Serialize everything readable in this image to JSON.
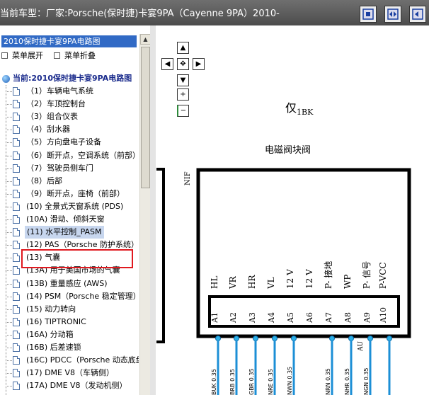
{
  "window": {
    "title": "当前车型：厂家:Porsche(保时捷)卡宴9PA（Cayenne 9PA）2010-"
  },
  "toolbar": {
    "buttons": [
      "layout-single-icon",
      "layout-split-icon",
      "layout-triple-icon"
    ]
  },
  "sidebar": {
    "header": "2010保时捷卡宴9PA电路图",
    "expand_label": "菜单展开",
    "collapse_label": "菜单折叠",
    "root_label": "当前:2010保时捷卡宴9PA电路图",
    "items": [
      "（1）车辆电气系统",
      "（2）车顶控制台",
      "（3）组合仪表",
      "（4）刮水器",
      "（5）方向盘电子设备",
      "（6）断开点，空调系统（前部）",
      "（7）驾驶员侧车门",
      "（8）后部",
      "（9）断开点，座椅（前部）",
      "(10) 全景式天窗系统 (PDS)",
      "(10A) 滑动、倾斜天窗",
      "(11) 水平控制_PASM",
      "(12) PAS（Porsche 防护系统）",
      "(13) 气囊",
      "(13A) 用于美国市场的气囊",
      "(13B) 重量感应 (AWS)",
      "(14) PSM（Porsche 稳定管理）",
      "(15) 动力转向",
      "(16) TIPTRONIC",
      "(16A) 分动箱",
      "(16B) 后差速锁",
      "(16C) PDCC（Porsche 动态底盘）",
      "(17) DME V8（车辆侧）",
      "(17A) DME V8（发动机侧）"
    ],
    "selected_index": 11
  },
  "diagram": {
    "zoom_in": "+",
    "zoom_out": "−",
    "heading_main": "仅",
    "heading_sub": "1BK",
    "module_title": "电磁阀块阀",
    "side_label": "NIF",
    "signals": [
      "HL",
      "VR",
      "HR",
      "VL",
      "12 V",
      "12 V",
      "P- 接地",
      "WP",
      "P- 信号",
      "P-VCC"
    ],
    "pins": [
      "A1",
      "A2",
      "A3",
      "A4",
      "A5",
      "A6",
      "A7",
      "A8",
      "A9",
      "A10"
    ],
    "wire_labels": [
      "BUK 0.35",
      "BRB 0.35",
      "GBR 0.35",
      "NRE 0.35",
      "NWN 0.35",
      "NRN 0.35",
      "NHR 0.35",
      "NGN 0.35"
    ],
    "au_label": "AU",
    "wire_color": "#1c8fd6"
  }
}
